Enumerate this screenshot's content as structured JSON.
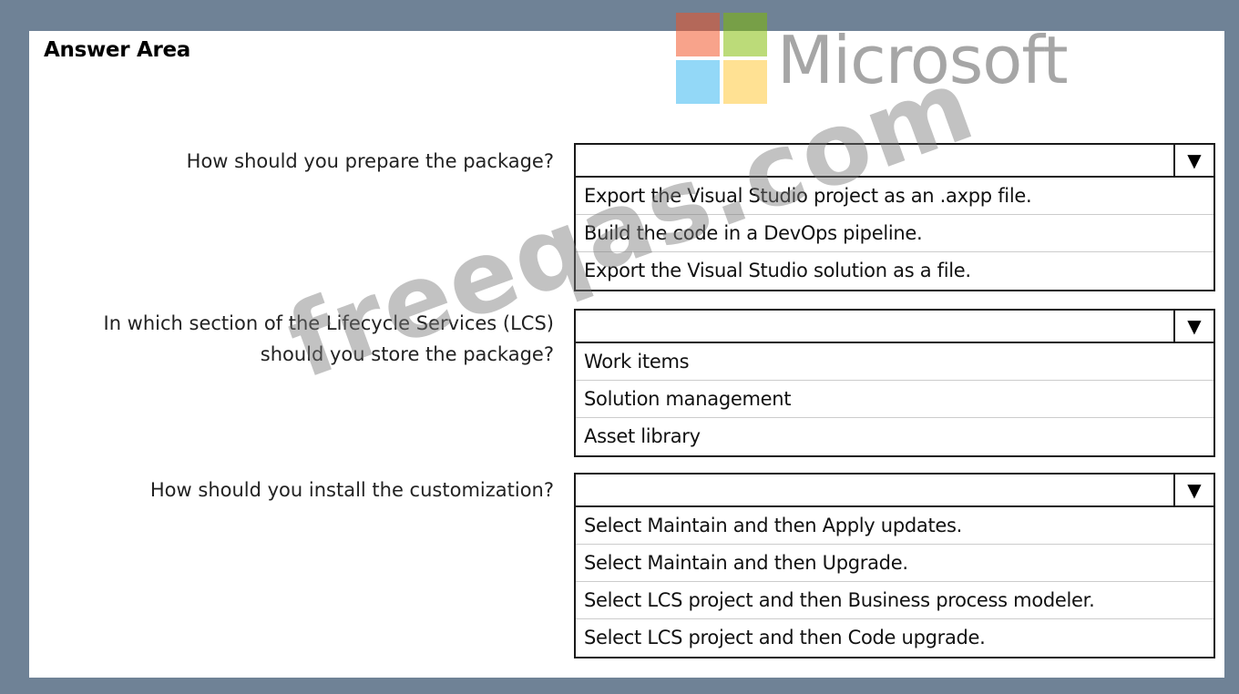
{
  "header": {
    "title": "Answer Area",
    "brand": "Microsoft",
    "logo_colors": [
      "#f25022",
      "#7fba00",
      "#00a4ef",
      "#ffb900"
    ]
  },
  "questions": [
    {
      "text_lines": [
        "How should you prepare the package?"
      ],
      "selected": "",
      "options": [
        "Export the Visual Studio project as an .axpp file.",
        "Build the code in a DevOps pipeline.",
        "Export the Visual Studio solution as a file."
      ]
    },
    {
      "text_lines": [
        "In which section of the Lifecycle Services (LCS)",
        "should you store the package?"
      ],
      "selected": "",
      "options": [
        "Work items",
        "Solution management",
        "Asset library"
      ]
    },
    {
      "text_lines": [
        "How should you install the customization?"
      ],
      "selected": "",
      "options": [
        "Select Maintain and then Apply updates.",
        "Select Maintain and then Upgrade.",
        "Select LCS project and then Business process modeler.",
        "Select LCS project and then Code upgrade."
      ]
    }
  ],
  "dropdown_arrow": "▼",
  "watermark": "freeqas.com"
}
